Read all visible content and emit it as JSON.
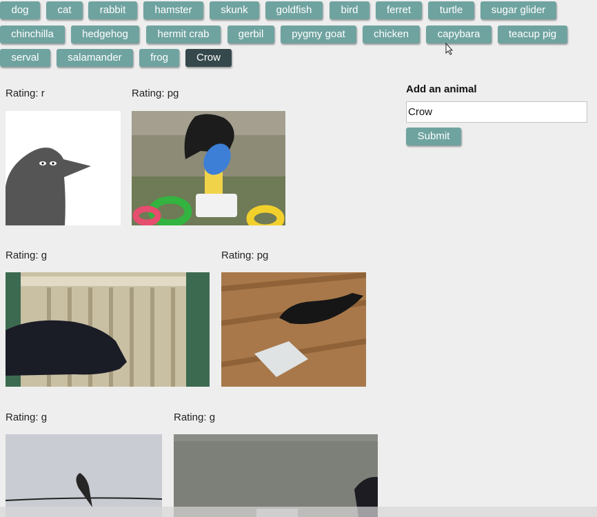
{
  "buttons": [
    [
      "dog",
      "cat",
      "rabbit",
      "hamster",
      "skunk",
      "goldfish",
      "bird",
      "ferret",
      "turtle",
      "sugar glider"
    ],
    [
      "chinchilla",
      "hedgehog",
      "hermit crab",
      "gerbil",
      "pygmy goat",
      "chicken",
      "capybara",
      "teacup pig"
    ],
    [
      "serval",
      "salamander",
      "frog",
      "Crow"
    ]
  ],
  "active_button": "Crow",
  "gifs": [
    {
      "rating": "Rating: r",
      "image": "cartoon-crow"
    },
    {
      "rating": "Rating: pg",
      "image": "crow-ring-toy"
    },
    {
      "rating": "Rating: g",
      "image": "crow-at-cage"
    },
    {
      "rating": "Rating: pg",
      "image": "crow-food-tray"
    },
    {
      "rating": "Rating: g",
      "image": "crow-on-wire"
    },
    {
      "rating": "Rating: g",
      "image": "crow-tv-footage"
    }
  ],
  "form": {
    "title": "Add an animal",
    "input_value": "Crow",
    "submit_label": "Submit"
  },
  "colors": {
    "button": "#6fa3a0",
    "button_active": "#35484b",
    "background": "#eeeeee"
  }
}
